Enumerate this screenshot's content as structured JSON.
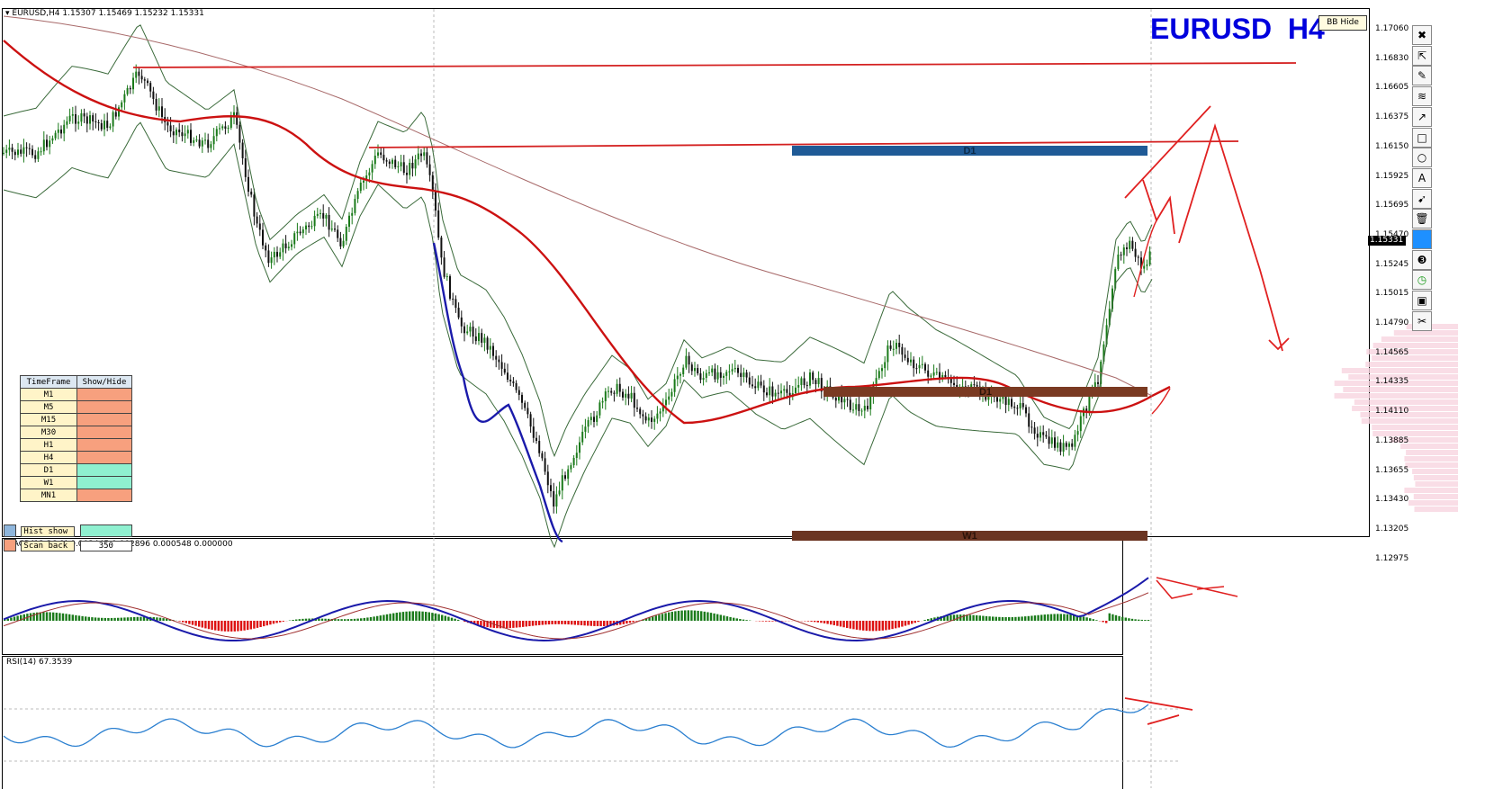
{
  "chart": {
    "header": "EURUSD,H4  1.15307 1.15469 1.15232 1.15331",
    "watermark": "EURUSD  H4",
    "bb_hide_button": "BB Hide",
    "current_price": "1.15331",
    "price_ticks": [
      "1.17060",
      "1.16830",
      "1.16605",
      "1.16375",
      "1.16150",
      "1.15925",
      "1.15695",
      "1.15470",
      "1.15245",
      "1.15015",
      "1.14790",
      "1.14565",
      "1.14335",
      "1.14110",
      "1.13885",
      "1.13655",
      "1.13430",
      "1.13205",
      "1.12975"
    ],
    "zones": [
      {
        "label": "D1",
        "color": "#1f5a96"
      },
      {
        "label": "D1",
        "color": "#7a3a22"
      },
      {
        "label": "W1",
        "color": "#6b3522"
      }
    ],
    "colors": {
      "bull": "#1a7a1a",
      "bear": "#111111",
      "ma_red": "#cc1111",
      "bb": "#3a6a3a",
      "watermark": "#0000dd",
      "macd_pos": "#1a7a1a",
      "macd_neg": "#dd1111",
      "rsi": "#2a7fd0"
    }
  },
  "macd": {
    "label": "MACD(12,26,9) 0.003445 0.002896 0.000548 0.000000"
  },
  "rsi": {
    "label": "RSI(14) 67.3539"
  },
  "timeframe_panel": {
    "header": [
      "TimeFrame",
      "Show/Hide"
    ],
    "rows": [
      {
        "tf": "M1",
        "state": "off"
      },
      {
        "tf": "M5",
        "state": "off"
      },
      {
        "tf": "M15",
        "state": "off"
      },
      {
        "tf": "M30",
        "state": "off"
      },
      {
        "tf": "H1",
        "state": "off"
      },
      {
        "tf": "H4",
        "state": "off"
      },
      {
        "tf": "D1",
        "state": "on"
      },
      {
        "tf": "W1",
        "state": "on"
      },
      {
        "tf": "MN1",
        "state": "off"
      }
    ],
    "hist_show": "Hist show",
    "scan_back": "Scan back",
    "scan_back_value": "350",
    "on_color": "#8ff0d0",
    "off_color": "#f7a07e"
  },
  "toolbar_icons": [
    "close-icon",
    "cursor-icon",
    "pencil-icon",
    "fibonacci-icon",
    "arrow-icon",
    "rectangle-icon",
    "ellipse-icon",
    "text-icon",
    "pointer-icon",
    "trash-icon",
    "color-icon",
    "number-3-icon",
    "clock-icon",
    "save-icon",
    "scissors-icon"
  ]
}
